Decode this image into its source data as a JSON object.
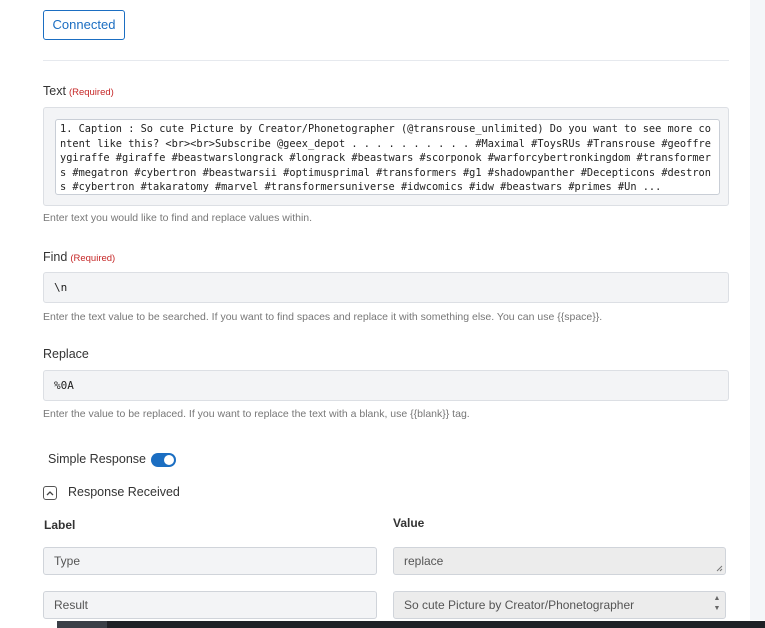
{
  "connected_button": "Connected",
  "text_section": {
    "label": "Text",
    "required": "(Required)",
    "value": "1. Caption : So cute Picture by Creator/Phonetographer (@transrouse_unlimited) Do you want to see more content like this? <br><br>Subscribe @geex_depot . . . . . . . . . . #Maximal #ToysRUs #Transrouse #geoffreygiraffe #giraffe #beastwarslongrack #longrack #beastwars #scorponok #warforcybertronkingdom #transformers #megatron #cybertron #beastwarsii #optimusprimal #transformers #g1 #shadowpanther #Decepticons #destrons #cybertron #takaratomy #marvel #transformersuniverse #idwcomics #idw #beastwars #primes #Un ...",
    "hint": "Enter text you would like to find and replace values within."
  },
  "find_section": {
    "label": "Find",
    "required": "(Required)",
    "value": "\\n",
    "hint": "Enter the text value to be searched. If you want to find spaces and replace it with something else. You can use {{space}}."
  },
  "replace_section": {
    "label": "Replace",
    "value": "%0A",
    "hint": "Enter the value to be replaced. If you want to replace the text with a blank, use {{blank}} tag."
  },
  "simple_response": {
    "label": "Simple Response",
    "enabled": true
  },
  "response_received": {
    "label": "Response Received",
    "col_label": "Label",
    "col_value": "Value",
    "rows": [
      {
        "label": "Type",
        "value": "replace"
      },
      {
        "label": "Result",
        "value": "So cute Picture by Creator/Phonetographer"
      }
    ]
  },
  "colors": {
    "accent": "#1b6ec2",
    "required": "#c62828"
  }
}
